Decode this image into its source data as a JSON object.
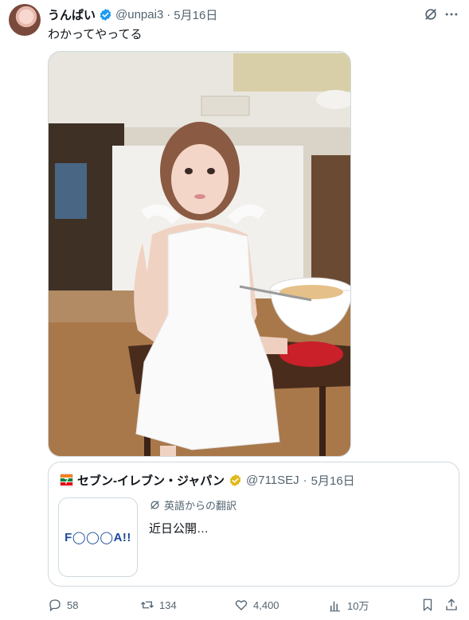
{
  "post": {
    "display_name": "うんぱい",
    "handle": "@unpai3",
    "separator": "·",
    "date": "5月16日",
    "text": "わかってやってる"
  },
  "quote": {
    "display_name": "セブン‐イレブン・ジャパン",
    "handle": "@711SEJ",
    "separator": "·",
    "date": "5月16日",
    "translation_label": "英語からの翻訳",
    "text": "近日公開…",
    "thumbnail_text": "F◯◯◯A!!"
  },
  "actions": {
    "replies": "58",
    "reposts": "134",
    "likes": "4,400",
    "views": "10万"
  },
  "colors": {
    "verified_blue": "#1d9bf0",
    "verified_gold": "#e2b719",
    "muted_text": "#536471",
    "border": "#cfd9de",
    "brand_red": "#e60012",
    "brand_green": "#00843d",
    "brand_orange": "#f58220"
  },
  "icons": [
    "verified-badge-icon",
    "grok-icon",
    "more-icon",
    "translate-icon",
    "reply-icon",
    "repost-icon",
    "like-icon",
    "views-icon",
    "bookmark-icon",
    "share-icon"
  ]
}
